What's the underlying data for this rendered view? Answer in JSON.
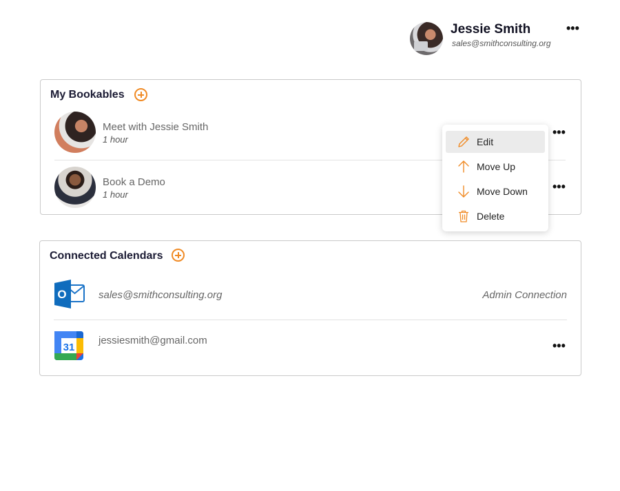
{
  "profile": {
    "name": "Jessie Smith",
    "email": "sales@smithconsulting.org",
    "more_label": "•••"
  },
  "bookables": {
    "title": "My Bookables",
    "items": [
      {
        "title": "Meet with Jessie Smith",
        "duration": "1 hour",
        "more_label": "•••"
      },
      {
        "title": "Book a Demo",
        "duration": "1 hour",
        "more_label": "•••"
      }
    ]
  },
  "menu": {
    "items": [
      {
        "label": "Edit",
        "icon": "pencil-icon",
        "active": true
      },
      {
        "label": "Move Up",
        "icon": "arrow-up-icon"
      },
      {
        "label": "Move Down",
        "icon": "arrow-down-icon"
      },
      {
        "label": "Delete",
        "icon": "trash-icon"
      }
    ]
  },
  "calendars": {
    "title": "Connected Calendars",
    "items": [
      {
        "provider": "outlook-icon",
        "email": "sales@smithconsulting.org",
        "note": "Admin Connection",
        "icon_letter": "O"
      },
      {
        "provider": "google-calendar-icon",
        "email": "jessiesmith@gmail.com",
        "icon_number": "31",
        "more_label": "•••"
      }
    ]
  },
  "colors": {
    "accent": "#f08a24",
    "menu_active": "#ebebeb",
    "outlook_blue": "#0f6cbd"
  }
}
